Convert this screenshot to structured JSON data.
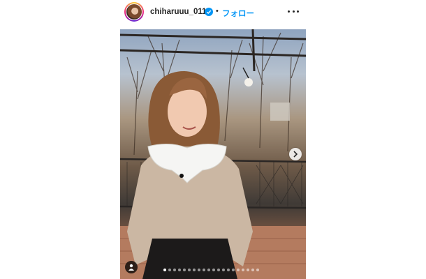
{
  "post": {
    "username": "chiharuuu_0114",
    "separator": "•",
    "follow_label": "フォロー",
    "verified": true,
    "accent_color": "#0095f6"
  },
  "carousel": {
    "total_slides": 20,
    "active_index": 0
  },
  "icons": {
    "verified": "verified-badge-icon",
    "more": "more-options-icon",
    "next": "chevron-right-icon",
    "tag": "user-tag-icon"
  }
}
